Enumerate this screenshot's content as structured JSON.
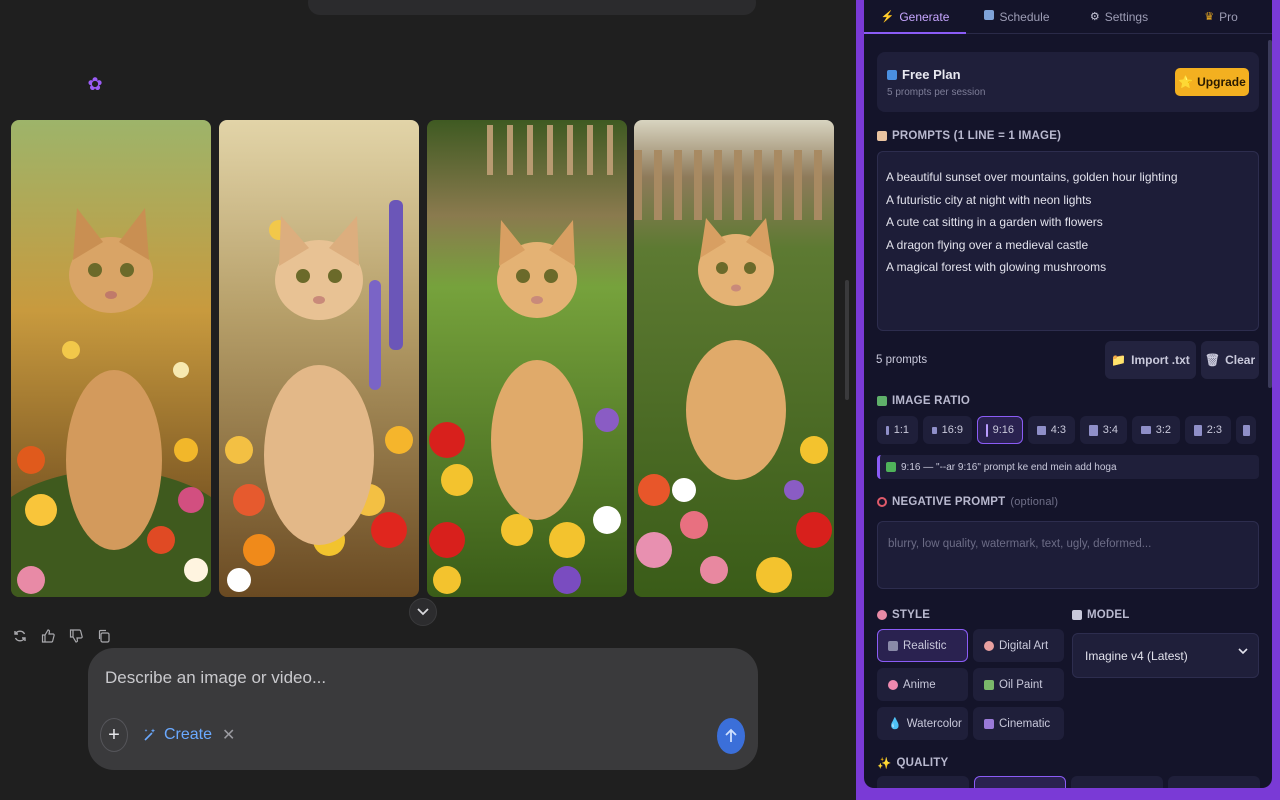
{
  "composer": {
    "placeholder": "Describe an image or video...",
    "create_label": "Create"
  },
  "tabs": [
    {
      "label": "Generate",
      "icon": "lightning-icon"
    },
    {
      "label": "Schedule",
      "icon": "calendar-icon"
    },
    {
      "label": "Settings",
      "icon": "gear-icon"
    },
    {
      "label": "Pro",
      "icon": "crown-icon"
    }
  ],
  "plan": {
    "title": "Free Plan",
    "subtitle": "5 prompts per session",
    "upgrade_label": "Upgrade"
  },
  "prompts": {
    "label": "PROMPTS (1 LINE = 1 IMAGE)",
    "lines": [
      "A beautiful sunset over mountains, golden hour lighting",
      "A futuristic city at night with neon lights",
      "A cute cat sitting in a garden with flowers",
      "A dragon flying over a medieval castle",
      "A magical forest with glowing mushrooms"
    ],
    "count": "5 prompts",
    "import_label": "Import .txt",
    "clear_label": "Clear"
  },
  "ratio": {
    "label": "IMAGE RATIO",
    "options": [
      "1:1",
      "16:9",
      "9:16",
      "4:3",
      "3:4",
      "3:2",
      "2:3"
    ],
    "selected": "9:16",
    "info": "9:16 — \"--ar 9:16\" prompt ke end mein add hoga"
  },
  "negative": {
    "label": "NEGATIVE PROMPT",
    "optional": "(optional)",
    "placeholder": "blurry, low quality, watermark, text, ugly, deformed..."
  },
  "style": {
    "label": "STYLE",
    "options": [
      "Realistic",
      "Digital Art",
      "Anime",
      "Oil Paint",
      "Watercolor",
      "Cinematic"
    ],
    "selected": "Realistic"
  },
  "model": {
    "label": "MODEL",
    "value": "Imagine v4 (Latest)"
  },
  "quality": {
    "label": "QUALITY"
  },
  "colors": {
    "accent": "#8b5cf6",
    "panel_border": "#7a3ad6",
    "upgrade": "#f3b020",
    "send": "#3b6fd9"
  }
}
